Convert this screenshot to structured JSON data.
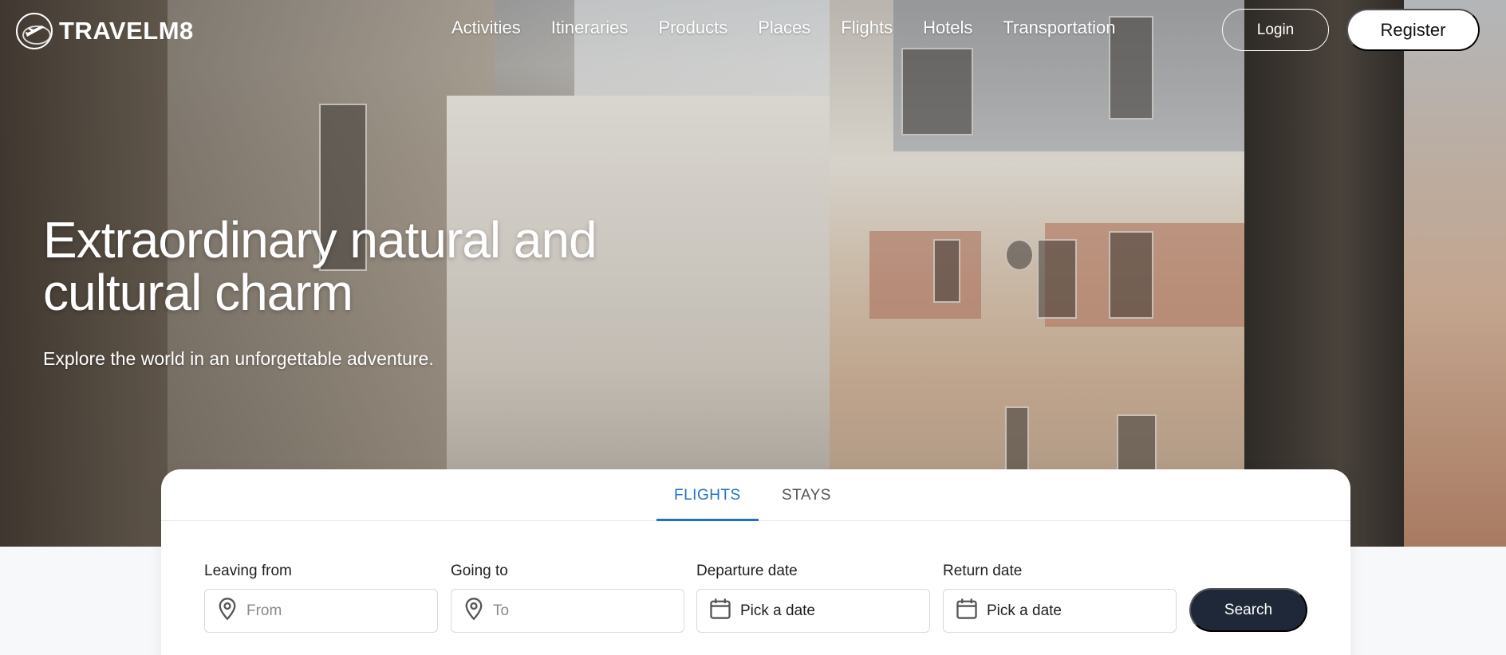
{
  "brand": {
    "name": "TRAVELM8",
    "logo_icon": "globe-plane-icon"
  },
  "nav": {
    "items": [
      "Activities",
      "Itineraries",
      "Products",
      "Places",
      "Flights",
      "Hotels",
      "Transportation"
    ],
    "login_label": "Login",
    "register_label": "Register"
  },
  "hero": {
    "headline_line1": "Extraordinary natural and",
    "headline_line2": "cultural charm",
    "subheadline": "Explore the world in an unforgettable adventure."
  },
  "search": {
    "tabs": [
      {
        "label": "FLIGHTS",
        "active": true
      },
      {
        "label": "STAYS",
        "active": false
      }
    ],
    "leaving": {
      "label": "Leaving from",
      "placeholder": "From",
      "icon": "map-pin-icon"
    },
    "going": {
      "label": "Going to",
      "placeholder": "To",
      "icon": "map-pin-icon"
    },
    "departure": {
      "label": "Departure date",
      "value": "Pick a date",
      "icon": "calendar-icon"
    },
    "return": {
      "label": "Return date",
      "value": "Pick a date",
      "icon": "calendar-icon"
    },
    "search_label": "Search"
  },
  "colors": {
    "accent": "#1e73c7",
    "button_dark": "#1e2838",
    "background": "#f7f8fa"
  }
}
